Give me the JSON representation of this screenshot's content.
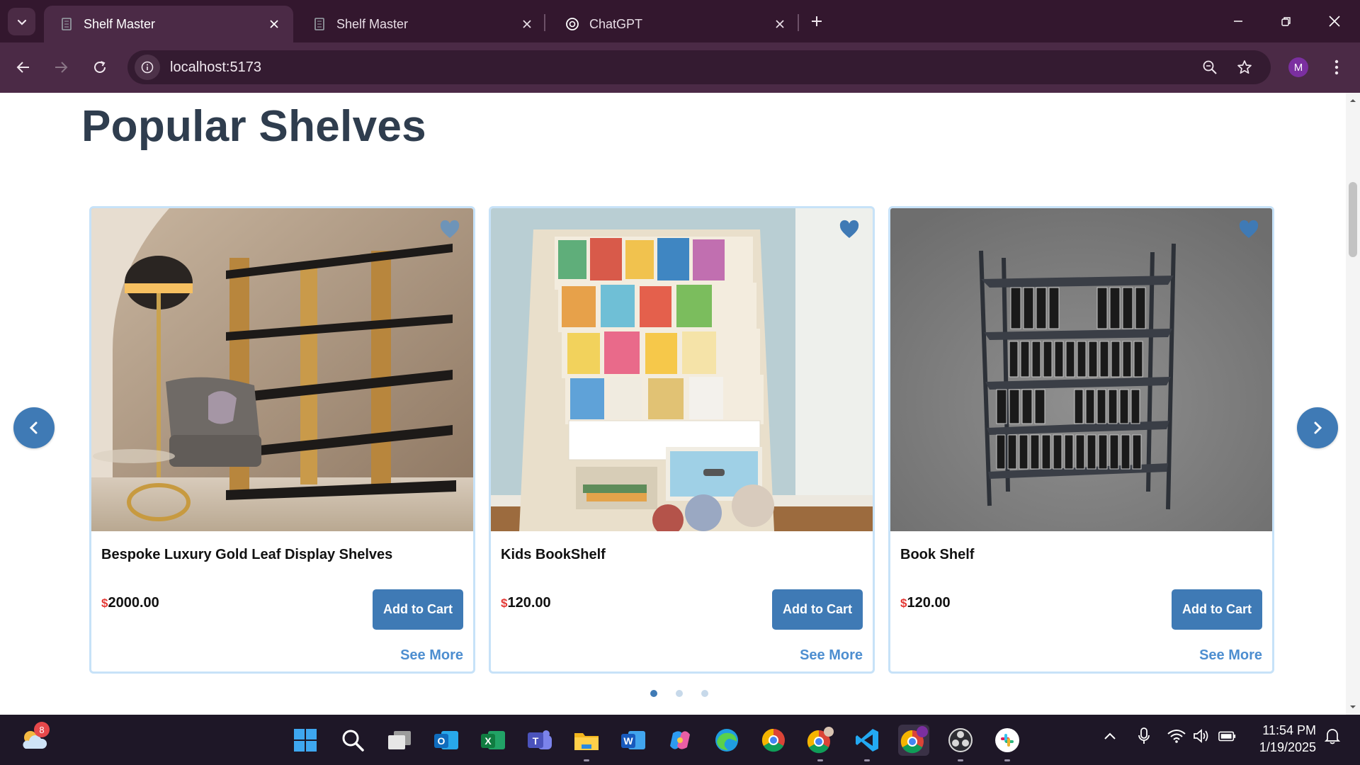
{
  "browser": {
    "tabs": [
      {
        "title": "Shelf Master",
        "active": true
      },
      {
        "title": "Shelf Master",
        "active": false
      },
      {
        "title": "ChatGPT",
        "active": false
      }
    ],
    "url": "localhost:5173",
    "profile_initial": "M",
    "icons": {
      "tab_search": "chevron-down-icon",
      "new_tab": "plus-icon",
      "back": "arrow-left-icon",
      "forward": "arrow-right-icon",
      "reload": "reload-icon",
      "site_info": "info-icon",
      "zoom": "zoom-icon",
      "bookmark": "star-icon",
      "menu": "kebab-menu-icon"
    },
    "colors": {
      "frame": "#33172e",
      "toolbar": "#4b2a46",
      "omnibox": "#341b31"
    }
  },
  "page": {
    "section_title": "Popular Shelves",
    "currency_symbol": "$",
    "products": [
      {
        "name": "Bespoke Luxury Gold Leaf Display Shelves",
        "price": "2000.00",
        "add_to_cart": "Add to Cart",
        "see_more": "See More",
        "favorite_icon": "heart-icon"
      },
      {
        "name": "Kids BookShelf",
        "price": "120.00",
        "add_to_cart": "Add to Cart",
        "see_more": "See More",
        "favorite_icon": "heart-icon"
      },
      {
        "name": "Book Shelf",
        "price": "120.00",
        "add_to_cart": "Add to Cart",
        "see_more": "See More",
        "favorite_icon": "heart-icon"
      }
    ],
    "carousel": {
      "pages": 3,
      "active_page": 1,
      "prev_icon": "chevron-left-icon",
      "next_icon": "chevron-right-icon"
    },
    "colors": {
      "accent": "#3f7ab5",
      "title": "#2f3d4e",
      "price_currency": "#e53935",
      "link": "#4d8ed0",
      "card_border": "#c7e2f8"
    }
  },
  "taskbar": {
    "weather_badge": "8",
    "clock": {
      "time": "11:54 PM",
      "date": "1/19/2025"
    },
    "apps": [
      "weather-icon",
      "start-icon",
      "search-icon",
      "task-view-icon",
      "outlook-icon",
      "excel-icon",
      "teams-icon",
      "file-explorer-icon",
      "word-icon",
      "copilot-icon",
      "edge-icon",
      "chrome-icon",
      "chrome-profile-icon",
      "vscode-icon",
      "chrome-active-icon",
      "obs-icon",
      "slack-icon"
    ],
    "tray": [
      "chevron-up-icon",
      "microphone-icon",
      "wifi-icon",
      "volume-icon",
      "battery-icon",
      "notifications-icon"
    ]
  }
}
